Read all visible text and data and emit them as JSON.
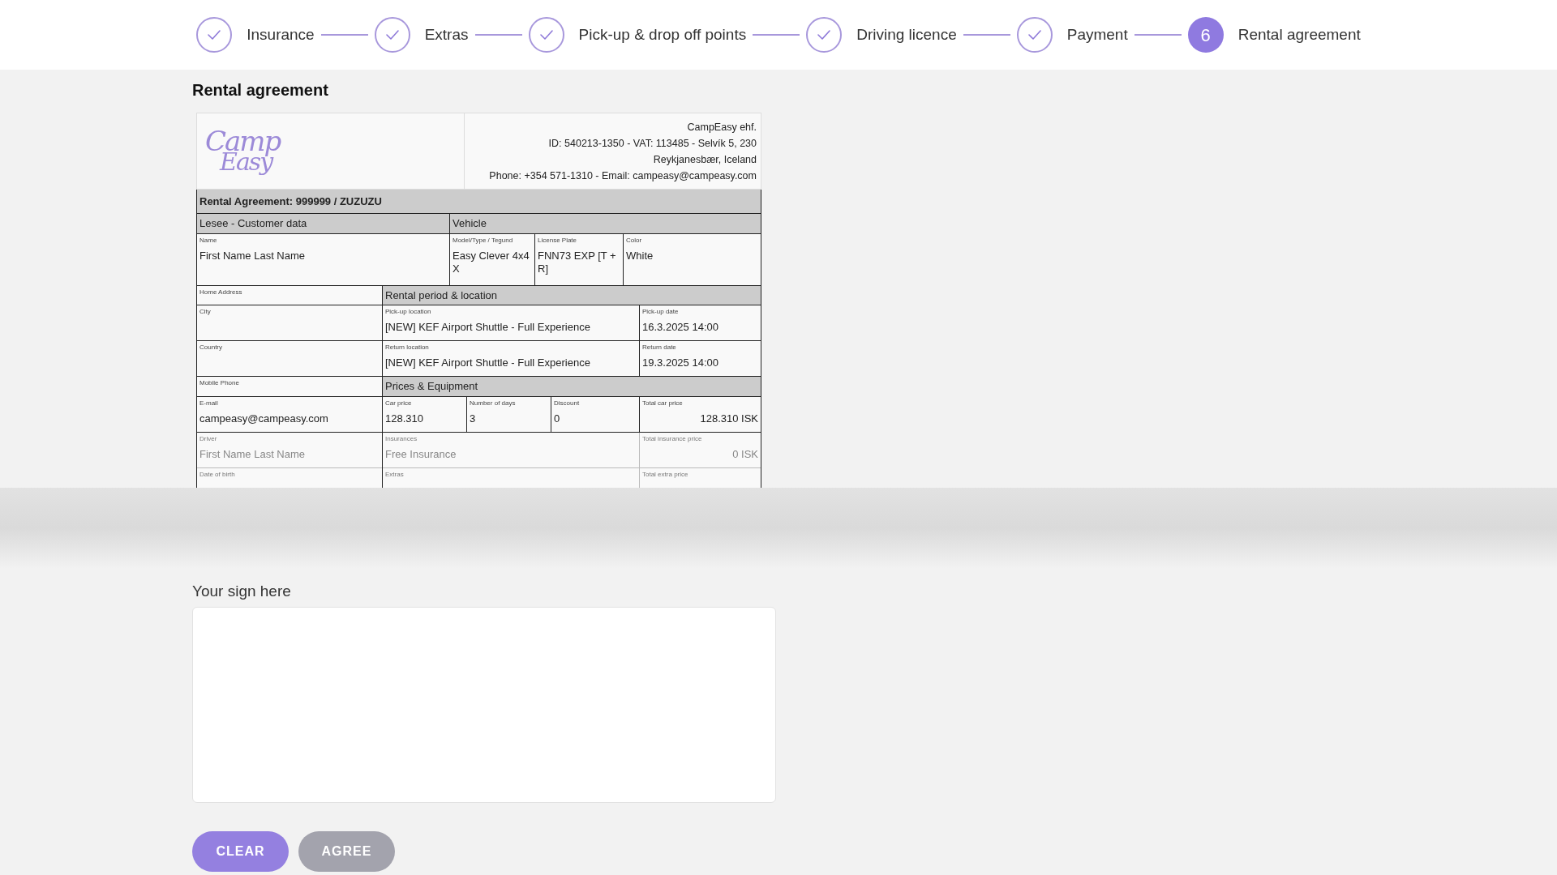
{
  "steps": [
    {
      "label": "Insurance",
      "completed": true
    },
    {
      "label": "Extras",
      "completed": true
    },
    {
      "label": "Pick-up & drop off points",
      "completed": true
    },
    {
      "label": "Driving licence",
      "completed": true
    },
    {
      "label": "Payment",
      "completed": true
    },
    {
      "label": "Rental agreement",
      "completed": false,
      "number": "6"
    }
  ],
  "page_title": "Rental agreement",
  "document": {
    "company_lines": [
      "CampEasy ehf.",
      "ID: 540213-1350 - VAT: 113485 - Selvík 5, 230",
      "Reykjanesbær, Iceland",
      "Phone: +354 571-1310 - Email: campeasy@campeasy.com"
    ],
    "logo": [
      "Camp",
      "Easy"
    ],
    "agreement_title": "Rental Agreement: 999999 / ZUZUZU",
    "customer": {
      "header": "Lesee - Customer data",
      "label": "Name",
      "value": "First Name Last Name"
    },
    "vehicle": {
      "header": "Vehicle",
      "fields": [
        {
          "label": "Model/Type / Tegund",
          "value": "Easy Clever 4x4 X"
        },
        {
          "label": "License Plate",
          "value": "FNN73 EXP [T + R]"
        },
        {
          "label": "Color",
          "value": "White"
        }
      ]
    },
    "customer_fields": [
      {
        "label": "Home Address",
        "faded": false
      },
      {
        "label": "City",
        "faded": false
      },
      {
        "label": "Country",
        "faded": false
      },
      {
        "label": "Mobile Phone",
        "faded": false
      },
      {
        "label": "E-mail",
        "value": "campeasy@campeasy.com",
        "faded": false
      },
      {
        "label": "Driver",
        "value": "First Name Last Name",
        "faded": true
      },
      {
        "label": "Date of birth",
        "faded": true
      }
    ],
    "rental": {
      "header": "Rental period & location",
      "fields": [
        {
          "label": "Pick-up location",
          "value": "[NEW] KEF Airport Shuttle - Full Experience"
        },
        {
          "label": "Pick-up date",
          "value": "16.3.2025 14:00"
        },
        {
          "label": "Return location",
          "value": "[NEW] KEF Airport Shuttle - Full Experience"
        },
        {
          "label": "Return date",
          "value": "19.3.2025 14:00"
        }
      ]
    },
    "prices": {
      "header": "Prices & Equipment",
      "rows": [
        {
          "faded": false,
          "cells": [
            {
              "label": "Car price",
              "value": "128.310"
            },
            {
              "label": "Number of days",
              "value": "3"
            },
            {
              "label": "Discount",
              "value": "0"
            },
            {
              "label": "Total car price",
              "value": "128.310 ISK"
            }
          ]
        },
        {
          "faded": true,
          "cells": [
            {
              "label": "Insurances",
              "value": "Free Insurance"
            },
            {
              "label": "Total insurance price",
              "value": "0 ISK"
            }
          ]
        },
        {
          "faded": true,
          "cells": [
            {
              "label": "Extras"
            },
            {
              "label": "Total extra price"
            }
          ]
        }
      ]
    }
  },
  "signature": {
    "label": "Your sign here"
  },
  "buttons": [
    {
      "label": "CLEAR",
      "disabled": false
    },
    {
      "label": "AGREE",
      "disabled": true
    }
  ]
}
